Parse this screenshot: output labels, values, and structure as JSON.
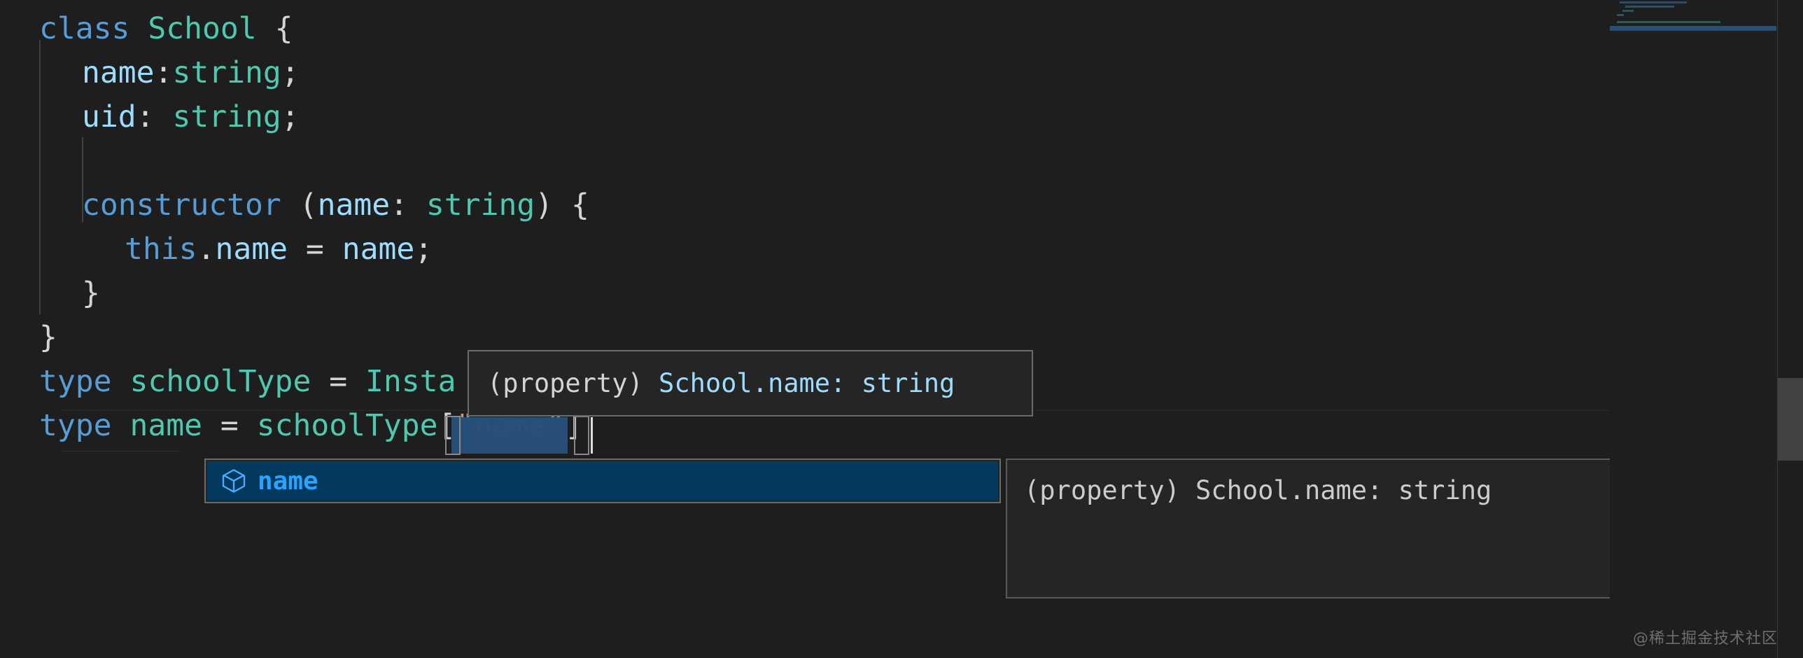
{
  "app": {
    "kind": "code-editor",
    "theme": "dark",
    "background": "#1e1e1e",
    "accent": "#04395e"
  },
  "editor": {
    "language": "typescript",
    "lines": [
      {
        "n": 1,
        "indent": 0,
        "tokens": [
          {
            "t": "class",
            "c": "kw"
          },
          {
            "t": " ",
            "c": "punc"
          },
          {
            "t": "School",
            "c": "type-g"
          },
          {
            "t": " {",
            "c": "punc"
          }
        ]
      },
      {
        "n": 2,
        "indent": 1,
        "tokens": [
          {
            "t": "name",
            "c": "var"
          },
          {
            "t": ":",
            "c": "punc"
          },
          {
            "t": "string",
            "c": "type-g"
          },
          {
            "t": ";",
            "c": "punc"
          }
        ]
      },
      {
        "n": 3,
        "indent": 1,
        "tokens": [
          {
            "t": "uid",
            "c": "var"
          },
          {
            "t": ": ",
            "c": "punc"
          },
          {
            "t": "string",
            "c": "type-g"
          },
          {
            "t": ";",
            "c": "punc"
          }
        ]
      },
      {
        "n": 4,
        "indent": 1,
        "tokens": []
      },
      {
        "n": 5,
        "indent": 1,
        "tokens": [
          {
            "t": "constructor",
            "c": "kw"
          },
          {
            "t": " (",
            "c": "punc"
          },
          {
            "t": "name",
            "c": "var"
          },
          {
            "t": ": ",
            "c": "punc"
          },
          {
            "t": "string",
            "c": "type-g"
          },
          {
            "t": ") {",
            "c": "punc"
          }
        ]
      },
      {
        "n": 6,
        "indent": 2,
        "tokens": [
          {
            "t": "this",
            "c": "kw"
          },
          {
            "t": ".",
            "c": "punc"
          },
          {
            "t": "name",
            "c": "var"
          },
          {
            "t": " = ",
            "c": "op"
          },
          {
            "t": "name",
            "c": "var"
          },
          {
            "t": ";",
            "c": "punc"
          }
        ]
      },
      {
        "n": 7,
        "indent": 1,
        "tokens": [
          {
            "t": "}",
            "c": "punc"
          }
        ]
      },
      {
        "n": 8,
        "indent": 0,
        "tokens": [
          {
            "t": "}",
            "c": "punc"
          }
        ]
      },
      {
        "n": 9,
        "indent": 0,
        "tokens": [
          {
            "t": "type",
            "c": "kw"
          },
          {
            "t": " ",
            "c": "punc"
          },
          {
            "t": "schoolType",
            "c": "type-g"
          },
          {
            "t": " = ",
            "c": "op"
          },
          {
            "t": "Insta",
            "c": "type-g"
          }
        ]
      },
      {
        "n": 10,
        "indent": 0,
        "tokens": [
          {
            "t": "type",
            "c": "kw"
          },
          {
            "t": " ",
            "c": "punc"
          },
          {
            "t": "name",
            "c": "type-g"
          },
          {
            "t": " = ",
            "c": "op"
          },
          {
            "t": "schoolType",
            "c": "type-g"
          },
          {
            "t": "[",
            "c": "punc"
          },
          {
            "t": "\"name\"",
            "c": "str"
          },
          {
            "t": "]",
            "c": "punc"
          }
        ]
      }
    ],
    "full_text": [
      "class School {",
      "  name:string;",
      "  uid: string;",
      "",
      "  constructor (name: string) {",
      "    this.name = name;",
      "  }",
      "}",
      "type schoolType = Insta",
      "type name = schoolType[\"name\"]"
    ]
  },
  "hover_tooltip": {
    "name": "hover-tooltip",
    "prefix": "(property) ",
    "signature": "School.name: string",
    "full": "(property) School.name: string"
  },
  "suggest_widget": {
    "items": [
      {
        "label": "name",
        "icon": "symbol-property-cube-icon",
        "selected": true
      }
    ],
    "selected_index": 0
  },
  "suggest_details": {
    "doc": "(property) School.name: string",
    "close_label": "×",
    "close_icon": "close-icon"
  },
  "watermark": {
    "text": "@稀土掘金技术社区"
  }
}
